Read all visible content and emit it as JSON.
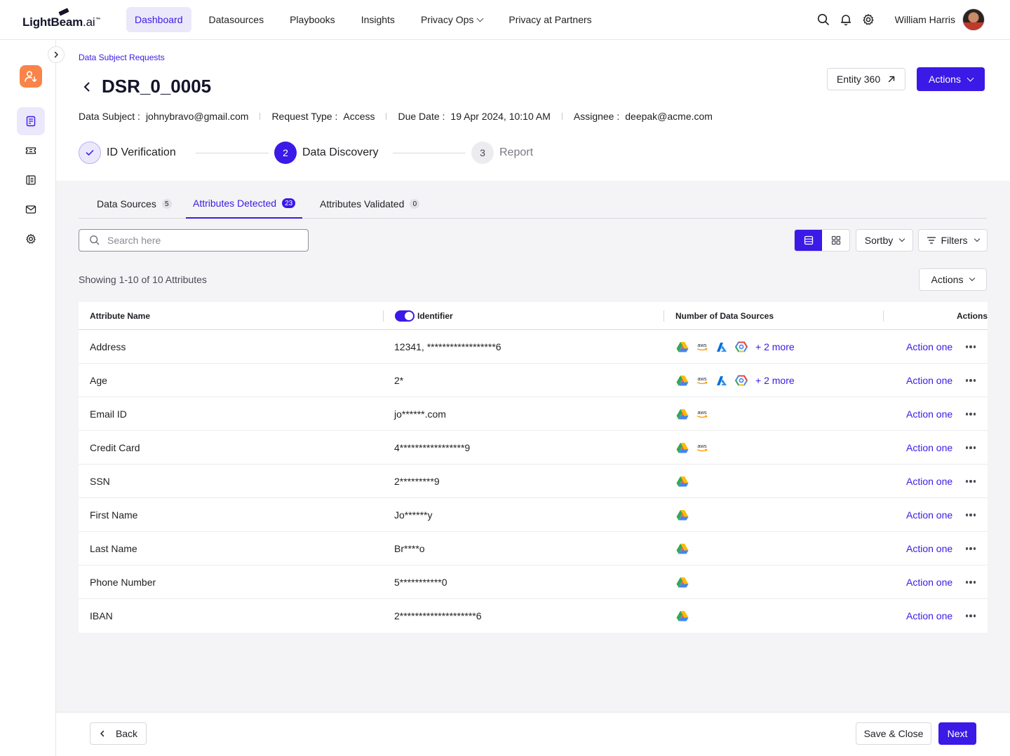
{
  "brand": {
    "logo_text": "LightBeam",
    "logo_suffix": ".ai",
    "logo_tm": "™"
  },
  "nav": {
    "items": [
      {
        "label": "Dashboard",
        "active": true
      },
      {
        "label": "Datasources"
      },
      {
        "label": "Playbooks"
      },
      {
        "label": "Insights"
      },
      {
        "label": "Privacy Ops",
        "has_dropdown": true
      },
      {
        "label": "Privacy at Partners"
      }
    ],
    "user_name": "William Harris",
    "icons": [
      "search-icon",
      "bell-icon",
      "gear-icon"
    ]
  },
  "sidebar": {
    "icons": [
      "user-request-icon",
      "document-list-icon",
      "ticket-icon",
      "ledger-icon",
      "mail-icon",
      "settings-icon"
    ]
  },
  "header": {
    "breadcrumb": "Data Subject Requests",
    "title": "DSR_0_0005",
    "entity_button": "Entity 360",
    "actions_button": "Actions",
    "meta": {
      "data_subject_label": "Data Subject :",
      "data_subject": "johnybravo@gmail.com",
      "request_type_label": "Request Type :",
      "request_type": "Access",
      "due_date_label": "Due Date :",
      "due_date": "19 Apr 2024, 10:10 AM",
      "assignee_label": "Assignee :",
      "assignee": "deepak@acme.com"
    }
  },
  "stepper": [
    {
      "number": "",
      "label": "ID Verification",
      "state": "done"
    },
    {
      "number": "2",
      "label": "Data Discovery",
      "state": "current"
    },
    {
      "number": "3",
      "label": "Report",
      "state": "upcoming"
    }
  ],
  "tabs": [
    {
      "label": "Data Sources",
      "count": "5"
    },
    {
      "label": "Attributes Detected",
      "count": "23",
      "active": true
    },
    {
      "label": "Attributes Validated",
      "count": "0"
    }
  ],
  "toolbar": {
    "search_placeholder": "Search here",
    "sortby": "Sortby",
    "filters": "Filters",
    "showing": "Showing 1-10 of 10 Attributes",
    "actions": "Actions"
  },
  "table": {
    "headers": {
      "name": "Attribute Name",
      "identifier": "Identifier",
      "sources": "Number of Data Sources",
      "actions": "Actions"
    },
    "rows": [
      {
        "name": "Address",
        "identifier": "12341, ******************6",
        "sources": [
          "gdrive",
          "aws",
          "azure",
          "gcp"
        ],
        "more": "+ 2 more",
        "action": "Action one"
      },
      {
        "name": "Age",
        "identifier": "2*",
        "sources": [
          "gdrive",
          "aws",
          "azure",
          "gcp"
        ],
        "more": "+ 2 more",
        "action": "Action one"
      },
      {
        "name": "Email ID",
        "identifier": "jo******.com",
        "sources": [
          "gdrive",
          "aws"
        ],
        "more": "",
        "action": "Action one"
      },
      {
        "name": "Credit Card",
        "identifier": "4*****************9",
        "sources": [
          "gdrive",
          "aws"
        ],
        "more": "",
        "action": "Action one"
      },
      {
        "name": "SSN",
        "identifier": "2*********9",
        "sources": [
          "gdrive"
        ],
        "more": "",
        "action": "Action one"
      },
      {
        "name": "First Name",
        "identifier": "Jo******y",
        "sources": [
          "gdrive"
        ],
        "more": "",
        "action": "Action one"
      },
      {
        "name": "Last Name",
        "identifier": "Br****o",
        "sources": [
          "gdrive"
        ],
        "more": "",
        "action": "Action one"
      },
      {
        "name": "Phone Number",
        "identifier": "5***********0",
        "sources": [
          "gdrive"
        ],
        "more": "",
        "action": "Action one"
      },
      {
        "name": "IBAN",
        "identifier": "2********************6",
        "sources": [
          "gdrive"
        ],
        "more": "",
        "action": "Action one"
      }
    ]
  },
  "footer": {
    "back": "Back",
    "save_close": "Save & Close",
    "next": "Next"
  },
  "colors": {
    "accent": "#3b19e6",
    "accent_light": "#ece8fb",
    "brand_orange": "#f9844a",
    "content_bg": "#f4f4f6"
  }
}
